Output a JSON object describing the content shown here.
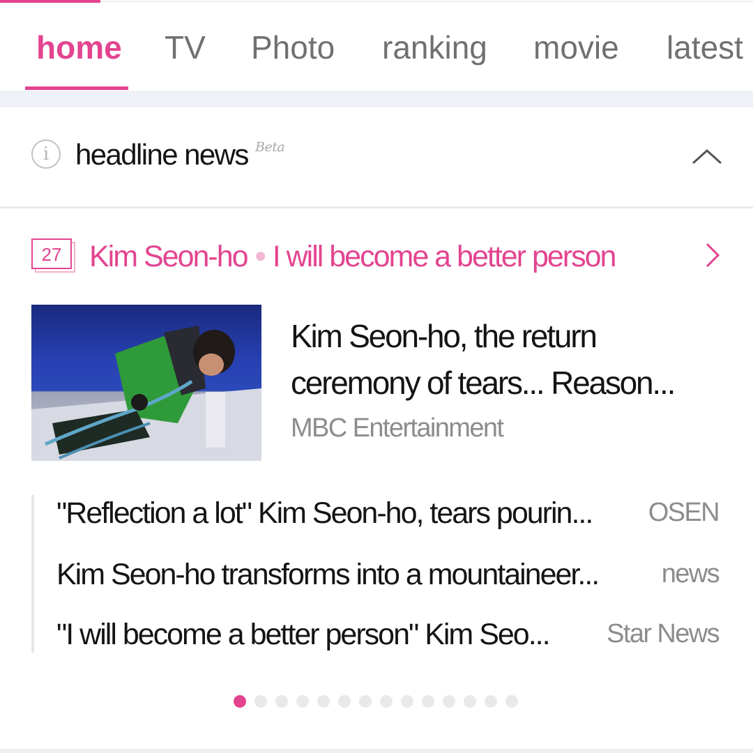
{
  "tabs": [
    {
      "label": "home",
      "active": true
    },
    {
      "label": "TV"
    },
    {
      "label": "Photo"
    },
    {
      "label": "ranking"
    },
    {
      "label": "movie"
    },
    {
      "label": "latest"
    }
  ],
  "headline": {
    "info_icon": "info-icon",
    "title": "headline news",
    "beta": "Beta",
    "collapse_icon": "chevron-up-icon"
  },
  "topic": {
    "calendar_day": "27",
    "person": "Kim Seon-ho",
    "quote": "I will become a better person",
    "arrow_icon": "chevron-right-icon"
  },
  "main_story": {
    "title": "Kim Seon-ho, the return ceremony of tears... Reason...",
    "source": "MBC Entertainment"
  },
  "related": [
    {
      "title": "\"Reflection a lot\" Kim Seon-ho, tears pourin...",
      "source": "OSEN"
    },
    {
      "title": "Kim Seon-ho transforms into a mountaineer...",
      "source": "news"
    },
    {
      "title": "\"I will become a better person\" Kim Seo...",
      "source": "Star News"
    }
  ],
  "pager": {
    "total": 14,
    "current": 1
  },
  "colors": {
    "accent": "#e3448f",
    "text": "#141414",
    "muted": "#8c8c8c"
  }
}
